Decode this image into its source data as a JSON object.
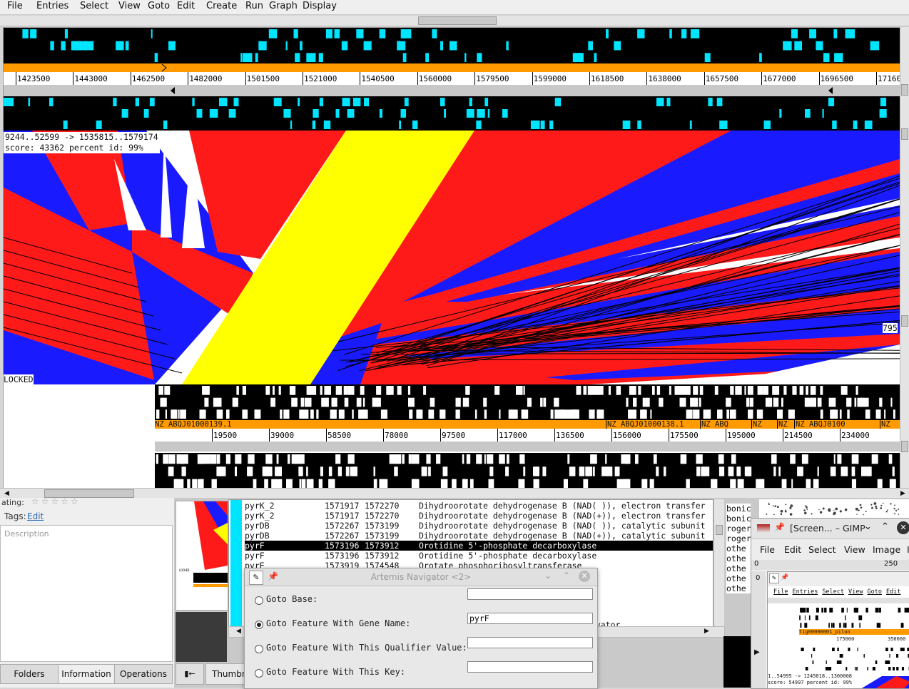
{
  "menubar": {
    "items": [
      {
        "label": "File"
      },
      {
        "label": "Entries"
      },
      {
        "label": "Select"
      },
      {
        "label": "View"
      },
      {
        "label": "Goto"
      },
      {
        "label": "Edit"
      },
      {
        "label": "Create"
      },
      {
        "label": "Run"
      },
      {
        "label": "Graph"
      },
      {
        "label": "Display"
      }
    ]
  },
  "top_ruler": [
    "1423500",
    "1443000",
    "1462500",
    "1482000",
    "1501500",
    "1521000",
    "1540500",
    "1560000",
    "1579500",
    "1599000",
    "1618500",
    "1638000",
    "1657500",
    "1677000",
    "1696500",
    "17160"
  ],
  "bottom_ruler": [
    "19500",
    "39000",
    "58500",
    "78000",
    "97500",
    "117000",
    "136500",
    "156000",
    "175500",
    "195000",
    "214500",
    "234000"
  ],
  "match_info": {
    "line1": "9244..52599 -> 1535815..1579174",
    "line2": "score: 43362  percent id: 99%"
  },
  "locked_label": "LOCKED",
  "side_number": "795",
  "contig_labels": {
    "first": "NZ ABQJ01000139.1",
    "second": "NZ ABQJ01000138.1",
    "third": "NZ ABQ",
    "short1": "NZ",
    "short2": "NZ",
    "fourth": "NZ ABQJ0100",
    "short3": "NZ"
  },
  "left_panel": {
    "rating_label": "ating:",
    "tags_label": "Tags:",
    "tags_edit": "Edit",
    "description_placeholder": "Description",
    "tabs": [
      {
        "label": "Folders"
      },
      {
        "label": "Information"
      },
      {
        "label": "Operations"
      }
    ],
    "thumb_label": "Thumbn",
    "back_btn": "▮←"
  },
  "feature_list": {
    "rows": [
      {
        "name": "pyrK_2",
        "start": "1571917",
        "end": "1572270",
        "product": "Dihydroorotate dehydrogenase B (NAD( )), electron transfer"
      },
      {
        "name": "pyrK_2",
        "start": "1571917",
        "end": "1572270",
        "product": "Dihydroorotate dehydrogenase B (NAD(+)), electron transfer"
      },
      {
        "name": "pyrDB",
        "start": "1572267",
        "end": "1573199",
        "product": "Dihydroorotate dehydrogenase B (NAD( )), catalytic subunit"
      },
      {
        "name": "pyrDB",
        "start": "1572267",
        "end": "1573199",
        "product": "Dihydroorotate dehydrogenase B (NAD(+)), catalytic subunit"
      },
      {
        "name": "pyrF",
        "start": "1573196",
        "end": "1573912",
        "product": "Orotidine 5'-phosphate decarboxylase"
      },
      {
        "name": "pyrF",
        "start": "1573196",
        "end": "1573912",
        "product": "Orotidine 5'-phosphate decarboxylase"
      },
      {
        "name": "pyrE",
        "start": "1573919",
        "end": "1574548",
        "product": "Orotate phosphoribosyltransferase"
      }
    ],
    "trailing_text": "tivator"
  },
  "right_snippets": [
    "bonic",
    "bonic",
    "roger",
    "roger",
    "othe",
    "othe",
    "othe",
    "othe",
    "othe"
  ],
  "navigator": {
    "title": "Artemis Navigator <2>",
    "options": [
      {
        "label": "Goto Base:",
        "value": "",
        "selected": false
      },
      {
        "label": "Goto Feature With Gene Name:",
        "value": "pyrF",
        "selected": true
      },
      {
        "label": "Goto Feature With This Qualifier Value:",
        "value": "",
        "selected": false
      },
      {
        "label": "Goto Feature With This Key:",
        "value": "",
        "selected": false
      }
    ]
  },
  "gimp": {
    "title": "[Screen... – GIMP",
    "menu": [
      {
        "label": "File"
      },
      {
        "label": "Edit"
      },
      {
        "label": "Select"
      },
      {
        "label": "View"
      },
      {
        "label": "Image"
      },
      {
        "label": "I"
      }
    ],
    "ruler_left": "0",
    "ruler_right": "250",
    "inner_menu": [
      "File",
      "Entries",
      "Select",
      "View",
      "Goto",
      "Edit"
    ],
    "inner_contig": "tig00000001_pilon",
    "inner_nums": [
      "175000",
      "350000"
    ],
    "inner_info1": "1..54995 -> 1245018..1300008",
    "inner_info2": "score: 54997  percent id: 99%"
  },
  "colors": {
    "forward": "#ff1a1a",
    "reverse": "#1a1aff",
    "selected": "#ffff00",
    "contig": "#ff9a00",
    "feature": "#00e5ff"
  }
}
